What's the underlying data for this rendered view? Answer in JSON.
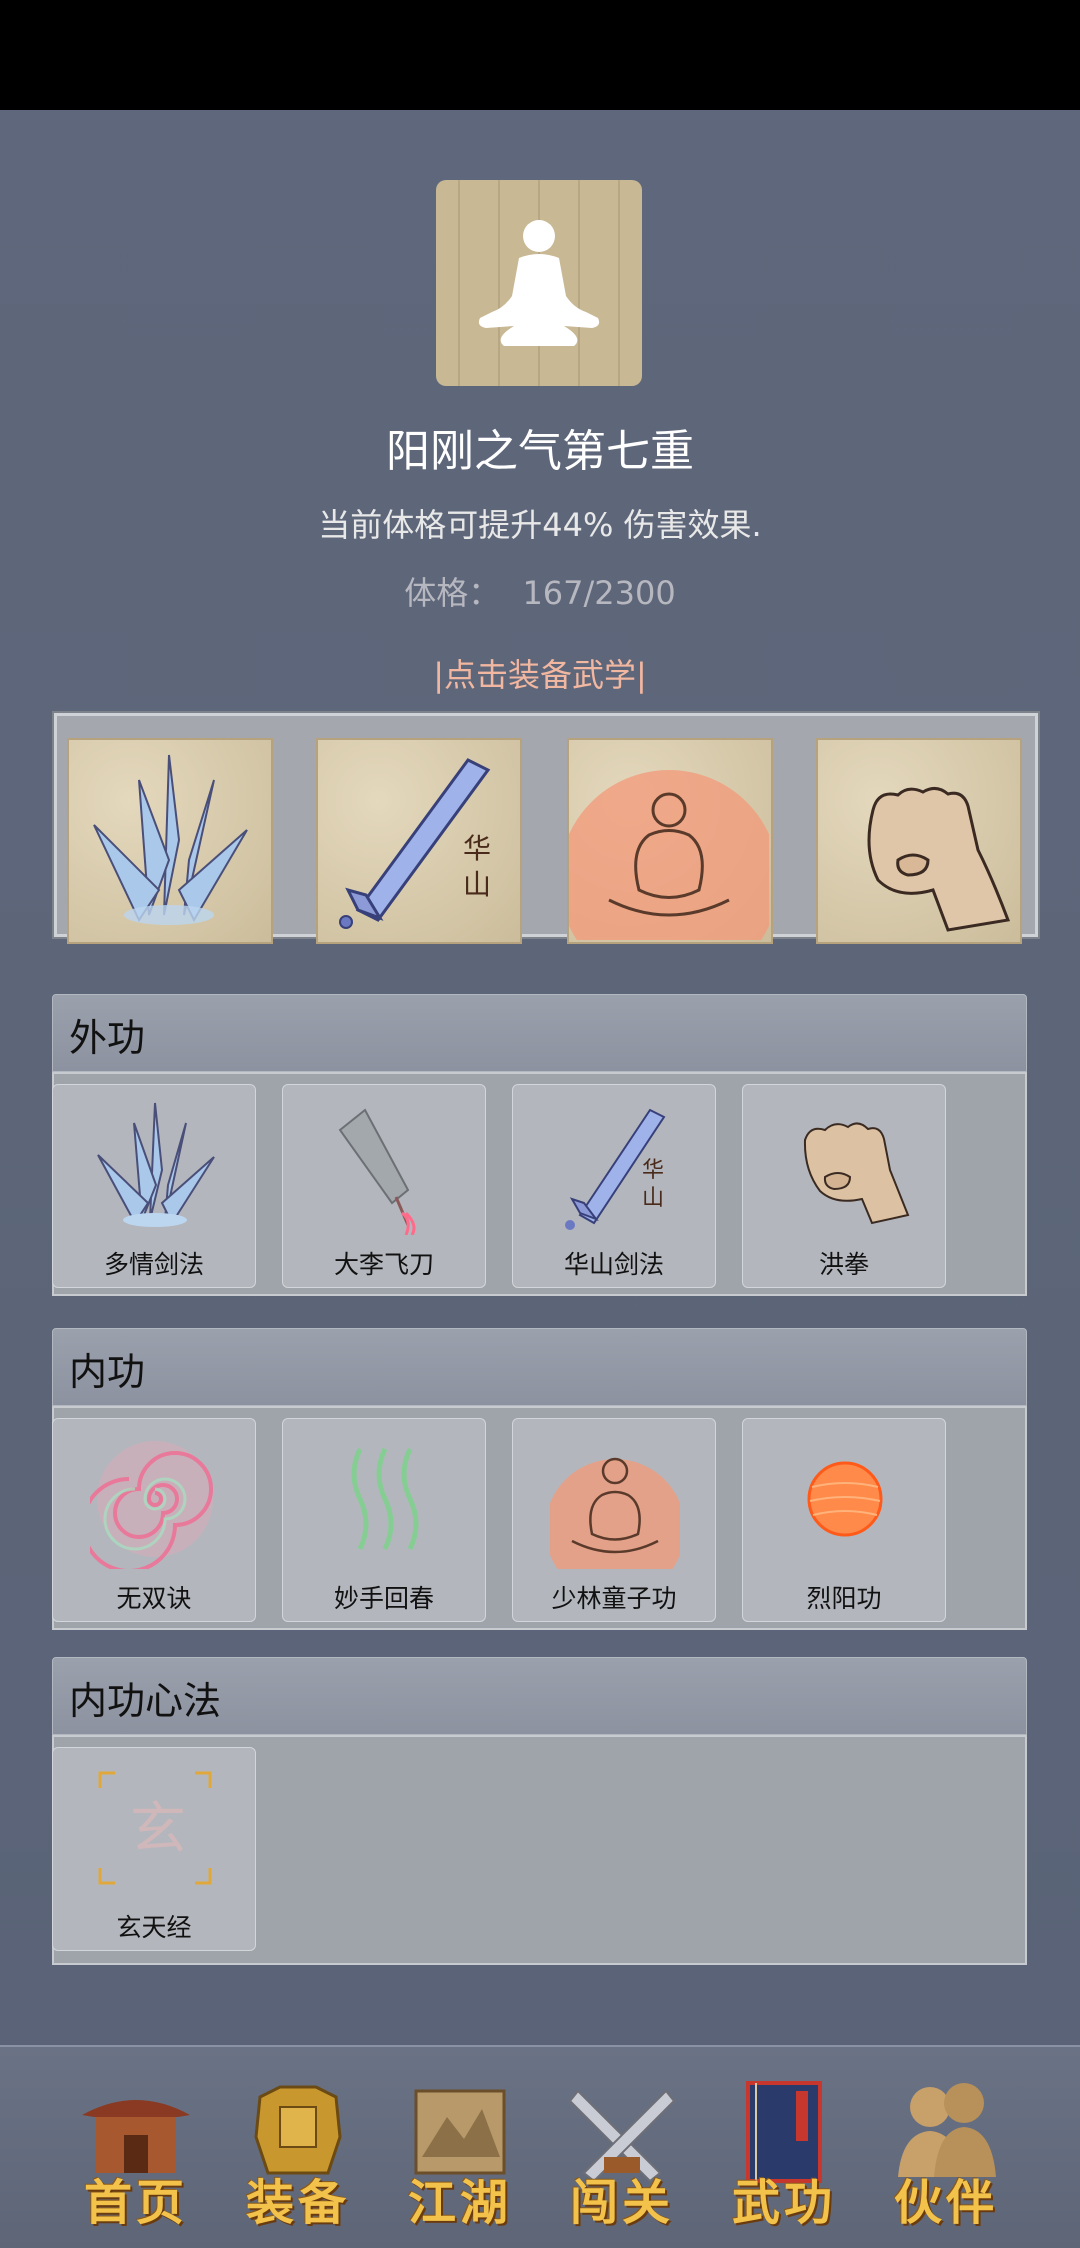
{
  "realm": {
    "title": "阳刚之气第七重",
    "description": "当前体格可提升44% 伤害效果.",
    "physique_label": "体格：",
    "physique_value": "167/2300"
  },
  "equip_link": "|点击装备武学|",
  "equipped": [
    {
      "icon": "crystal-claw-icon"
    },
    {
      "icon": "huashan-sword-icon",
      "glyph": "华\n山"
    },
    {
      "icon": "meditating-monk-icon"
    },
    {
      "icon": "fist-icon"
    }
  ],
  "sections": {
    "external": {
      "title": "外功",
      "skills": [
        {
          "name": "多情剑法",
          "icon": "crystal-claw-icon"
        },
        {
          "name": "大李飞刀",
          "icon": "flying-dagger-icon"
        },
        {
          "name": "华山剑法",
          "icon": "huashan-sword-icon"
        },
        {
          "name": "洪拳",
          "icon": "fist-icon"
        }
      ]
    },
    "internal": {
      "title": "内功",
      "skills": [
        {
          "name": "无双诀",
          "icon": "spiral-icon"
        },
        {
          "name": "妙手回春",
          "icon": "healing-waves-icon"
        },
        {
          "name": "少林童子功",
          "icon": "meditating-monk-icon"
        },
        {
          "name": "烈阳功",
          "icon": "sun-orb-icon"
        }
      ]
    },
    "mental": {
      "title": "内功心法",
      "skills": [
        {
          "name": "玄天经",
          "icon": "xuan-scroll-icon",
          "glyph": "玄"
        }
      ]
    }
  },
  "nav": [
    {
      "label": "首页",
      "icon": "home-pavilion-icon"
    },
    {
      "label": "装备",
      "icon": "armor-icon"
    },
    {
      "label": "江湖",
      "icon": "map-scroll-icon"
    },
    {
      "label": "闯关",
      "icon": "crossed-swords-icon"
    },
    {
      "label": "武功",
      "icon": "martial-book-icon"
    },
    {
      "label": "伙伴",
      "icon": "companions-icon"
    }
  ]
}
